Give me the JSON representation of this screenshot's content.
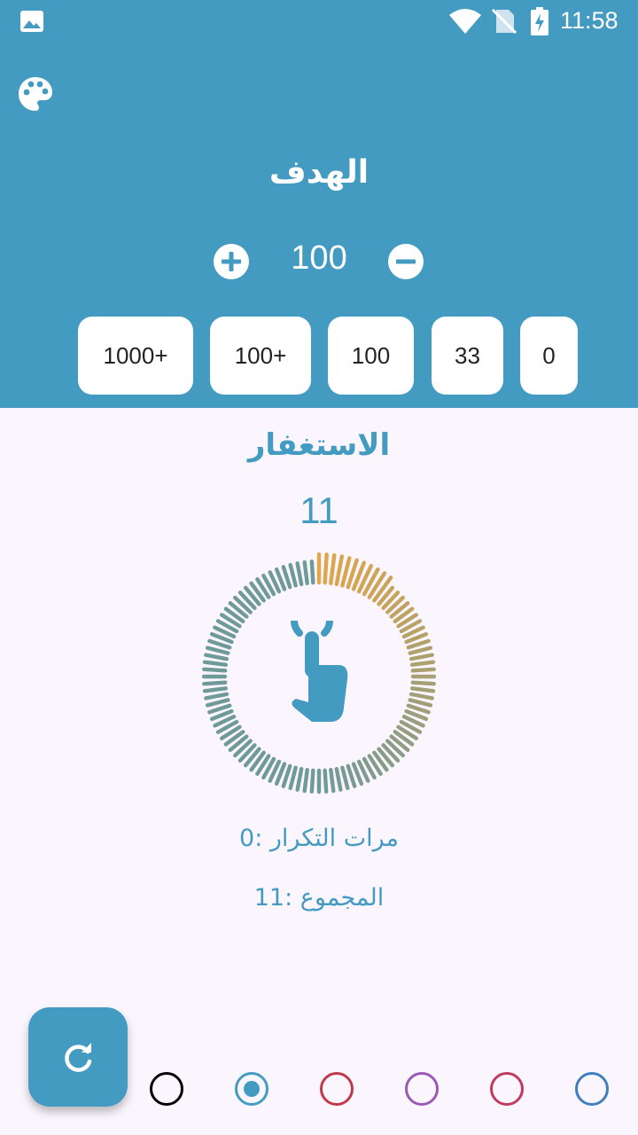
{
  "status_bar": {
    "time": "11:58",
    "icons": [
      "gallery-icon",
      "wifi-icon",
      "no-sim-icon",
      "battery-charging-icon"
    ]
  },
  "header": {
    "palette_icon": "palette-icon",
    "goal_title": "الهدف",
    "goal_value": "100",
    "plus_icon": "plus-circle-icon",
    "minus_icon": "minus-circle-icon",
    "presets": [
      "1000+",
      "100+",
      "100",
      "33",
      "0"
    ]
  },
  "counter": {
    "dhikr_title": "الاستغفار",
    "count": "11",
    "tap_icon": "tap-hand-icon",
    "progress_fraction": 0.11,
    "repetitions_label": "مرات التكرار :0",
    "total_label": "المجموع :11"
  },
  "bottom": {
    "reset_icon": "refresh-icon",
    "themes": [
      {
        "color": "#000000",
        "selected": false
      },
      {
        "color": "#449bc2",
        "selected": true
      },
      {
        "color": "#c0394b",
        "selected": false
      },
      {
        "color": "#9b59b6",
        "selected": false
      },
      {
        "color": "#c0395e",
        "selected": false
      },
      {
        "color": "#3d7fc1",
        "selected": false
      }
    ]
  },
  "colors": {
    "primary": "#449bc2",
    "ring_start": "#e0a74b",
    "ring_end": "#6f9a9a",
    "background": "#fbf5fd"
  }
}
